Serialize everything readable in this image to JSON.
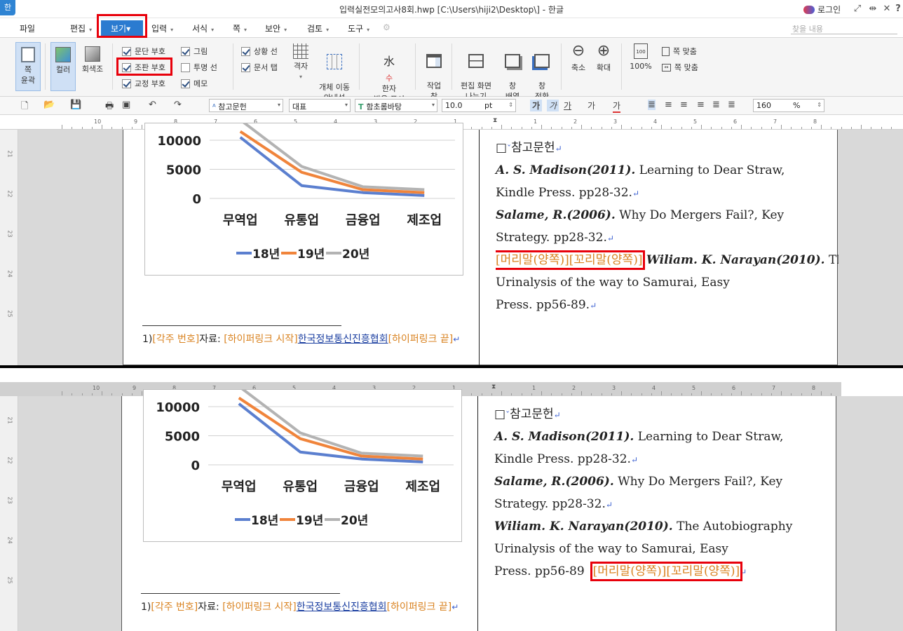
{
  "titlebar": {
    "app_logo": "한",
    "title": "입력실전모의고사8회.hwp [C:\\Users\\hiji2\\Desktop\\] - 한글",
    "login": "로그인",
    "icons": [
      "fullscreen-icon",
      "restore-icon",
      "close-icon",
      "help-icon"
    ]
  },
  "menu": {
    "items": [
      "파일",
      "편집",
      "보기",
      "입력",
      "서식",
      "쪽",
      "보안",
      "검토",
      "도구"
    ],
    "search_placeholder": "찾을 내용"
  },
  "ribbon": {
    "page_outline": "쪽\n윤곽",
    "color": "컬러",
    "grayscale": "회색조",
    "checks": [
      {
        "label": "문단 부호",
        "checked": true
      },
      {
        "label": "조판 부호",
        "checked": true
      },
      {
        "label": "교정 부호",
        "checked": true
      },
      {
        "label": "그림",
        "checked": true
      },
      {
        "label": "투명 선",
        "checked": false
      },
      {
        "label": "메모",
        "checked": true
      },
      {
        "label": "상황 선",
        "checked": true
      },
      {
        "label": "문서 탭",
        "checked": true
      }
    ],
    "grid": "격자",
    "object_move_guide": "개체 이동\n안내선",
    "hanja_pron": "한자\n발음 표시",
    "work_window": "작업\n창",
    "split_screen": "편집 화면\n나누기",
    "window_arrange": "창\n배열",
    "window_switch": "창\n전환",
    "zoom_out": "축소",
    "zoom_in": "확대",
    "zoom_100": "100%",
    "fit_page": "쪽 맞춤",
    "fit_width": "쪽 맞춤"
  },
  "toolbar2": {
    "style": "참고문헌",
    "lang": "대표",
    "font": "함초롬바탕",
    "size": "10.0",
    "size_unit": "pt",
    "zoom": "160",
    "zoom_unit": "%"
  },
  "ruler": {
    "left_numbers": [
      "10",
      "9",
      "8",
      "7",
      "6",
      "5",
      "4",
      "3",
      "2",
      "1"
    ],
    "right_numbers": [
      "1",
      "2",
      "3",
      "4",
      "5",
      "6",
      "7",
      "8"
    ],
    "v_numbers": [
      "21",
      "22",
      "23",
      "24",
      "25"
    ]
  },
  "chart_data": {
    "type": "line",
    "categories": [
      "무역업",
      "유통업",
      "금융업",
      "제조업"
    ],
    "series": [
      {
        "name": "18년",
        "color": "#5b7fcf",
        "values": [
          10500,
          2200,
          1000,
          500
        ]
      },
      {
        "name": "19년",
        "color": "#f0843b",
        "values": [
          11500,
          4500,
          1500,
          1000
        ]
      },
      {
        "name": "20년",
        "color": "#b3b3b3",
        "values": [
          13500,
          5500,
          2000,
          1500
        ]
      }
    ],
    "y_ticks": [
      "10000",
      "5000",
      "0"
    ],
    "ylim": [
      0,
      10000
    ],
    "visible_ylim": [
      0,
      11000
    ]
  },
  "doc": {
    "heading": "참고문헌",
    "ref1_author": "A. S. Madison(2011).",
    "ref1_rest": " Learning to Dear Straw,",
    "ref1_line2": "Kindle Press. pp28-32.",
    "ref2_author": "Salame, R.(2006).",
    "ref2_rest": " Why Do Mergers Fail?, Key",
    "ref2_line2": "Strategy. pp28-32.",
    "header_footer_code": "[머리말(양쪽)][꼬리말(양쪽)]",
    "ref3_author": "Wiliam. K. Narayan(2010).",
    "ref3_rest_top": " Th",
    "ref3_rest": " The Autobiography",
    "ref3_line2": "Urinalysis of the way to Samurai, Easy",
    "ref3_line3_top": "Press. pp56-89.",
    "ref3_line3_bottom": "Press. pp56-89",
    "footnote_num": "1)",
    "fn_code": "[각주 번호]",
    "fn_label": "자료: ",
    "fn_link_start": "[하이퍼링크 시작]",
    "fn_link_text": "한국정보통신진흥협회",
    "fn_link_end": "[하이퍼링크 끝]"
  },
  "colors": {
    "accent": "#2b7bd0",
    "highlight_box": "#e8000b",
    "control_code": "#d9821f"
  }
}
